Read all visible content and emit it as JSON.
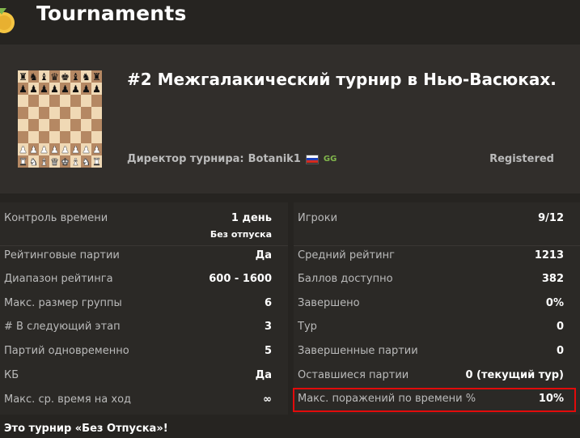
{
  "header": {
    "title": "Tournaments"
  },
  "tournament": {
    "title": "#2 Межгалакический турнир в Нью-Васюках.",
    "director_label": "Директор турнира:",
    "director_name": "Botanik1",
    "director_badge": "GG",
    "status": "Registered"
  },
  "left_stats": [
    {
      "label": "Контроль времени",
      "value": "1 день",
      "sub": "Без отпуска"
    },
    {
      "label": "Рейтинговые партии",
      "value": "Да"
    },
    {
      "label": "Диапазон рейтинга",
      "value": "600 - 1600"
    },
    {
      "label": "Макс. размер группы",
      "value": "6"
    },
    {
      "label": "# В следующий этап",
      "value": "3"
    },
    {
      "label": "Партий одновременно",
      "value": "5"
    },
    {
      "label": "КБ",
      "value": "Да"
    },
    {
      "label": "Макс. ср. время на ход",
      "value": "∞"
    }
  ],
  "right_stats": [
    {
      "label": "Игроки",
      "value": "9/12"
    },
    {
      "label": "Средний рейтинг",
      "value": "1213"
    },
    {
      "label": "Баллов доступно",
      "value": "382"
    },
    {
      "label": "Завершено",
      "value": "0%"
    },
    {
      "label": "Тур",
      "value": "0"
    },
    {
      "label": "Завершенные партии",
      "value": "0"
    },
    {
      "label": "Оставшиеся партии",
      "value": "0 (текущий тур)"
    },
    {
      "label": "Макс. поражений по времени %",
      "value": "10%"
    }
  ],
  "footer": {
    "note": "Это турнир «Без Отпуска»!"
  },
  "colors": {
    "background": "#262421",
    "card": "#312e2b",
    "highlight": "#e20b0b",
    "accent_green": "#81b64c"
  },
  "icons": {
    "header": "trophy-icon",
    "board": "chessboard-icon",
    "flag": "russia-flag-icon"
  }
}
